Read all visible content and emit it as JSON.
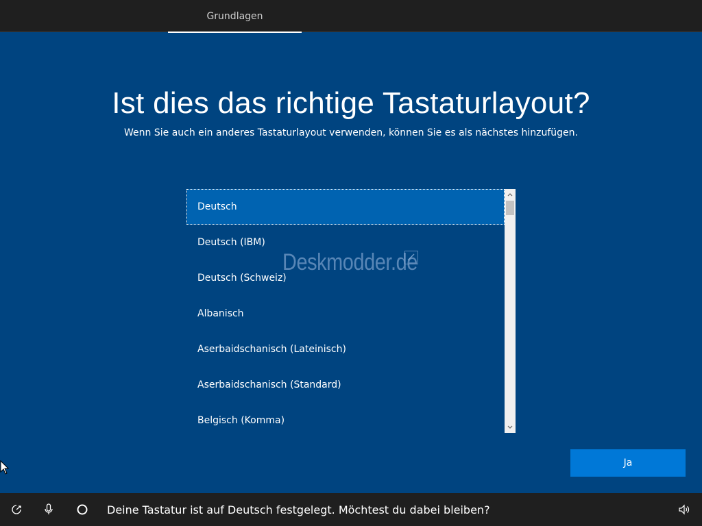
{
  "topbar": {
    "tab_label": "Grundlagen"
  },
  "header": {
    "title": "Ist dies das richtige Tastaturlayout?",
    "subtitle": "Wenn Sie auch ein anderes Tastaturlayout verwenden, können Sie es als nächstes hinzufügen."
  },
  "layout_list": {
    "selected_index": 0,
    "items": [
      {
        "label": "Deutsch"
      },
      {
        "label": "Deutsch (IBM)"
      },
      {
        "label": "Deutsch (Schweiz)"
      },
      {
        "label": "Albanisch"
      },
      {
        "label": "Aserbaidschanisch (Lateinisch)"
      },
      {
        "label": "Aserbaidschanisch (Standard)"
      },
      {
        "label": "Belgisch (Komma)"
      }
    ],
    "scroll_up_icon": "chevron-up-icon",
    "scroll_down_icon": "chevron-down-icon"
  },
  "watermark": {
    "text": "Deskmodder.de"
  },
  "actions": {
    "yes_label": "Ja",
    "yes_color": "#0078d7"
  },
  "bottombar": {
    "ease_of_access_icon": "ease-of-access-icon",
    "microphone_icon": "microphone-icon",
    "cortana_icon": "cortana-icon",
    "voice_prompt": "Deine Tastatur ist auf Deutsch festgelegt. Möchtest du dabei bleiben?",
    "volume_icon": "volume-icon"
  },
  "colors": {
    "background": "#004480",
    "bar": "#1f1f1f",
    "selection": "#0063b1"
  }
}
